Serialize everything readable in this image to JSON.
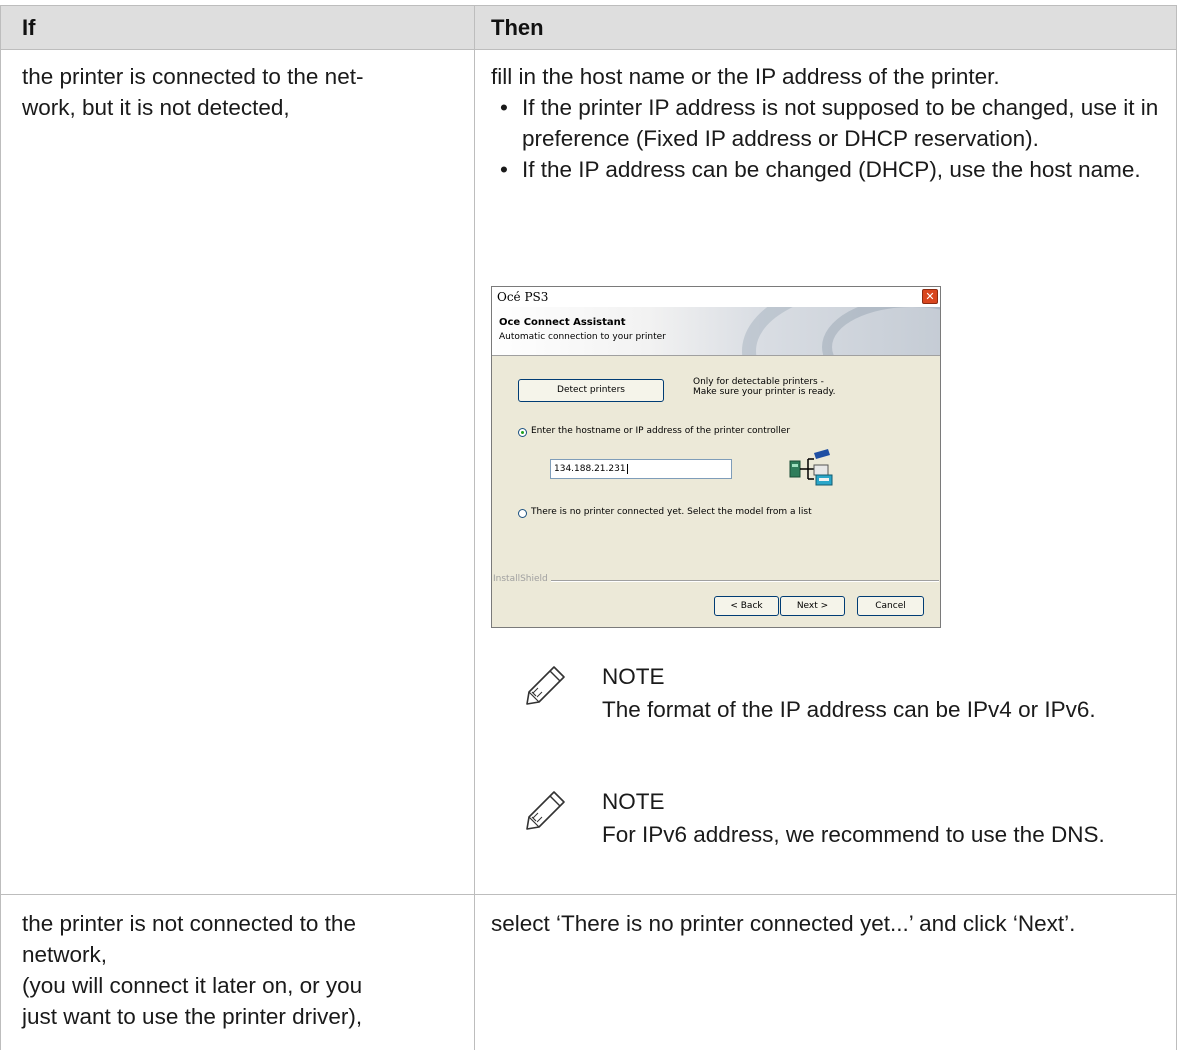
{
  "table": {
    "headers": {
      "if": "If",
      "then": "Then"
    },
    "rows": [
      {
        "if_lines": [
          "the printer is connected to the net-",
          "work, but it is not detected,"
        ],
        "then_intro": "fill in the host name or the IP address of the printer.",
        "bullets": [
          "If the printer IP address is not supposed to be changed, use it in preference (Fixed IP address or DHCP reservation).",
          "If the IP address can be changed (DHCP), use the host name."
        ],
        "notes": [
          {
            "title": "NOTE",
            "text": "The format of the IP address can be IPv4 or IPv6."
          },
          {
            "title": "NOTE",
            "text": "For IPv6 address, we recommend to use the DNS."
          }
        ]
      },
      {
        "if_lines": [
          "the printer is not connected to the",
          "network,",
          "(you will connect it later on, or you",
          "just want to use the printer driver),"
        ],
        "then_text": "select ‘There is no printer connected yet...’ and click ‘Next’."
      }
    ]
  },
  "dialog": {
    "window_title": "Océ PS3",
    "close_glyph": "✕",
    "banner_title": "Oce Connect Assistant",
    "banner_subtitle": "Automatic connection to your printer",
    "detect_button": "Detect printers",
    "detect_hint_line1": "Only for detectable printers -",
    "detect_hint_line2": "Make sure your printer is ready.",
    "option_hostname": "Enter the hostname or IP address of the printer controller",
    "ip_value": "134.188.21.231",
    "option_no_printer": "There is no printer connected yet. Select the model from a list",
    "installshield": "InstallShield",
    "back_button": "< Back",
    "next_button": "Next >",
    "cancel_button": "Cancel"
  }
}
